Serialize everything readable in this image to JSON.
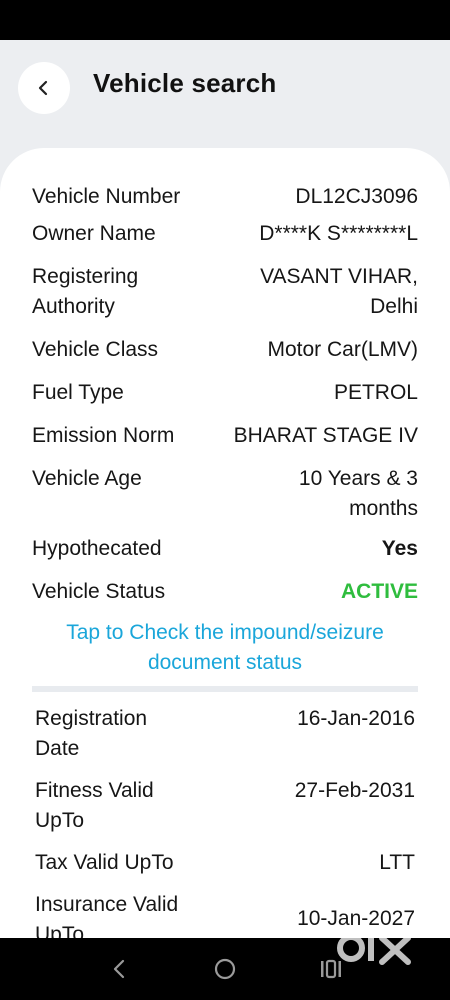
{
  "header": {
    "title": "Vehicle search"
  },
  "details": [
    {
      "label": "Vehicle Number",
      "value": "DL12CJ3096"
    },
    {
      "label": "Owner Name",
      "value": "D****K S********L"
    },
    {
      "label": "Registering Authority",
      "value": "VASANT VIHAR, Delhi"
    },
    {
      "label": "Vehicle Class",
      "value": "Motor Car(LMV)"
    },
    {
      "label": "Fuel Type",
      "value": "PETROL"
    },
    {
      "label": "Emission Norm",
      "value": "BHARAT STAGE IV"
    },
    {
      "label": "Vehicle Age",
      "value": "10 Years  & 3 months"
    },
    {
      "label": "Hypothecated",
      "value": "Yes"
    },
    {
      "label": "Vehicle Status",
      "value": "ACTIVE"
    }
  ],
  "impound_link": "Tap to Check the impound/seizure document status",
  "validity": [
    {
      "label": "Registration Date",
      "value": "16-Jan-2016"
    },
    {
      "label": "Fitness Valid UpTo",
      "value": "27-Feb-2031"
    },
    {
      "label": "Tax Valid UpTo",
      "value": "LTT"
    },
    {
      "label": "Insurance Valid UpTo",
      "value": "10-Jan-2027"
    }
  ],
  "colors": {
    "status_active": "#2fbd3e",
    "link": "#1aa6da"
  },
  "icons": [
    "back-arrow-icon",
    "nav-back-icon",
    "nav-home-icon",
    "nav-recents-icon"
  ],
  "watermark": "olx"
}
